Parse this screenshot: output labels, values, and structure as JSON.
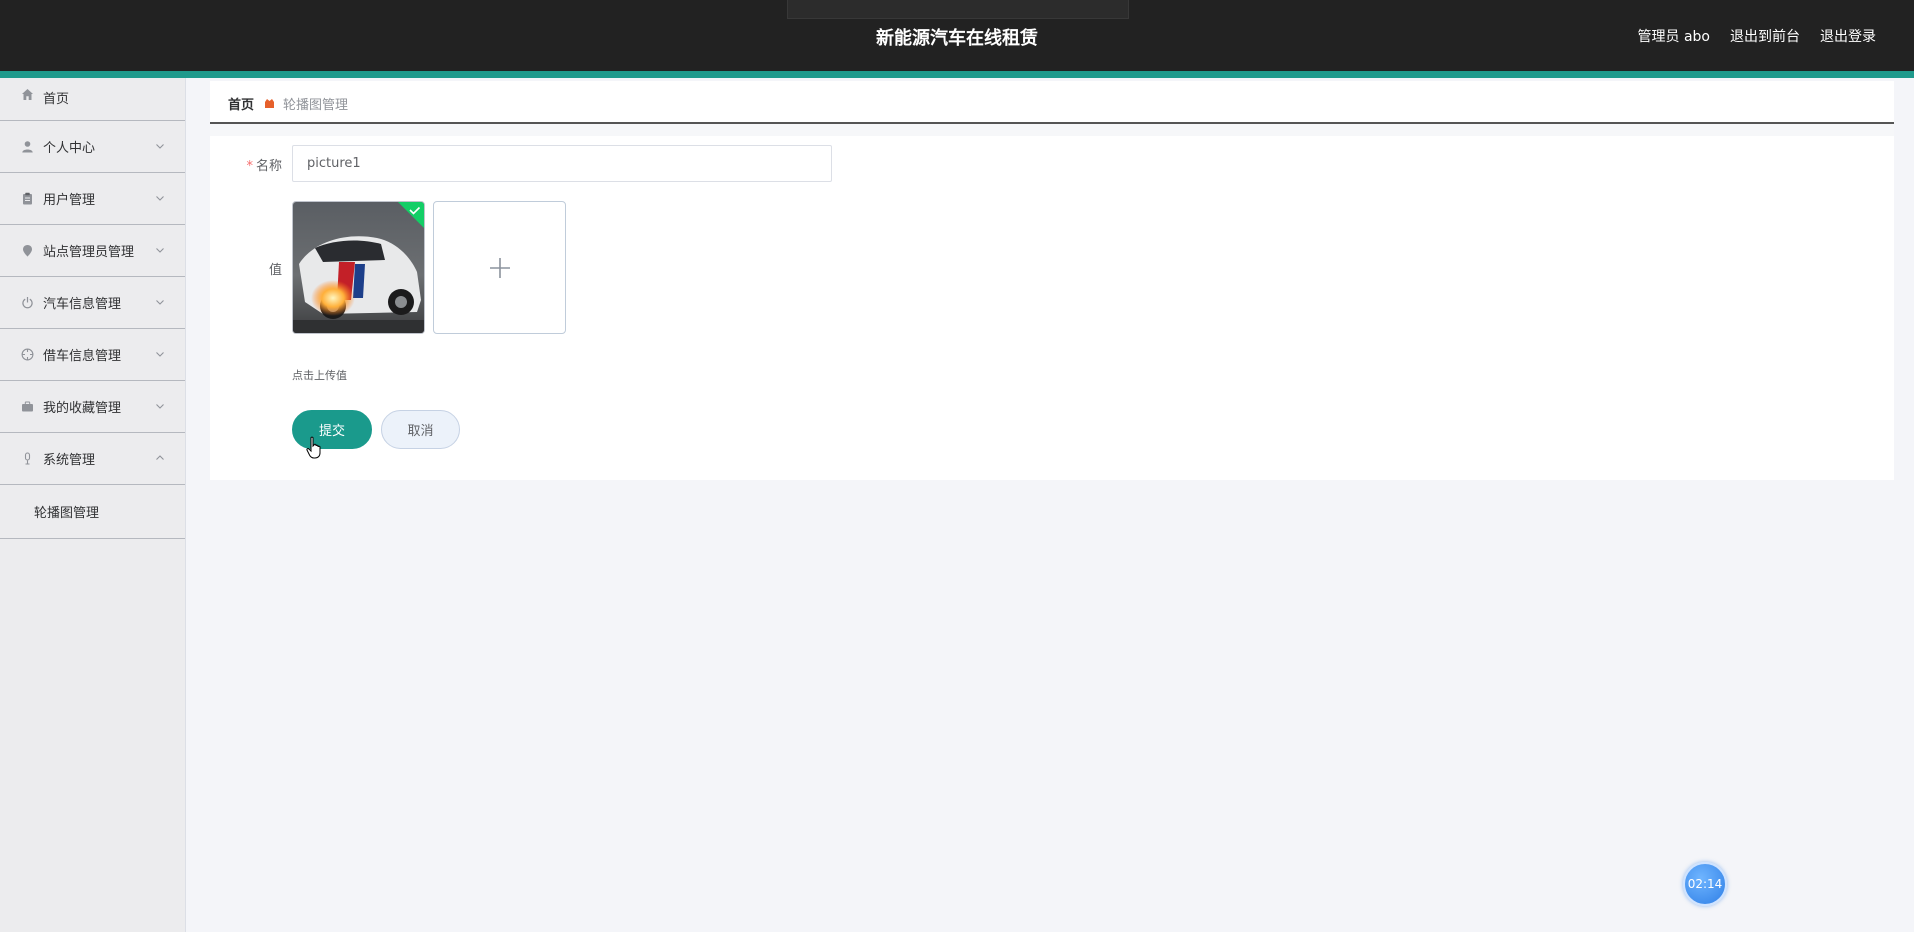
{
  "header": {
    "title": "新能源汽车在线租赁",
    "links": [
      "管理员 abo",
      "退出到前台",
      "退出登录"
    ],
    "accent_color": "#1f9a8c"
  },
  "sidebar": {
    "items": [
      {
        "label": "首页",
        "icon": "home-icon"
      },
      {
        "label": "个人中心",
        "icon": "user-icon"
      },
      {
        "label": "用户管理",
        "icon": "clipboard-icon"
      },
      {
        "label": "站点管理员管理",
        "icon": "location-pin-icon"
      },
      {
        "label": "汽车信息管理",
        "icon": "power-icon"
      },
      {
        "label": "借车信息管理",
        "icon": "compass-icon"
      },
      {
        "label": "我的收藏管理",
        "icon": "briefcase-icon"
      },
      {
        "label": "系统管理",
        "icon": "microphone-icon"
      }
    ],
    "submenu_item": "轮播图管理"
  },
  "breadcrumb": {
    "home": "首页",
    "current": "轮播图管理"
  },
  "form": {
    "name_label": "名称",
    "required_mark": "*",
    "name_value": "picture1",
    "value_label": "值",
    "upload_tip": "点击上传值",
    "submit_label": "提交",
    "cancel_label": "取消"
  },
  "timer": {
    "text": "02:14"
  }
}
